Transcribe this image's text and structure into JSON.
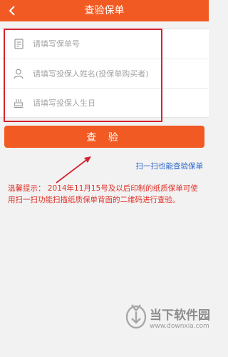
{
  "header": {
    "title": "查验保单",
    "back_icon": "chevron-left-icon"
  },
  "form": {
    "policy_number": {
      "placeholder": "请填写保单号",
      "icon": "document-icon"
    },
    "applicant_name": {
      "placeholder": "请填写投保人姓名(投保单购买者)",
      "icon": "person-icon"
    },
    "applicant_birthday": {
      "placeholder": "请填写投保人生日",
      "icon": "cake-icon"
    }
  },
  "verify_button": {
    "label": "查 验"
  },
  "scan_link": {
    "label": "扫一扫也能查验保单"
  },
  "tip": {
    "text": "温馨提示：  2014年11月15号及以后印制的纸质保单可使用扫一扫功能扫描纸质保单背面的二维码进行查验。"
  },
  "watermark": {
    "name": "当下软件园",
    "url": "www.downxia.com"
  },
  "colors": {
    "accent": "#f15a22",
    "link": "#2a66c9",
    "tip": "#e0332a",
    "annotation": "#d42430"
  }
}
